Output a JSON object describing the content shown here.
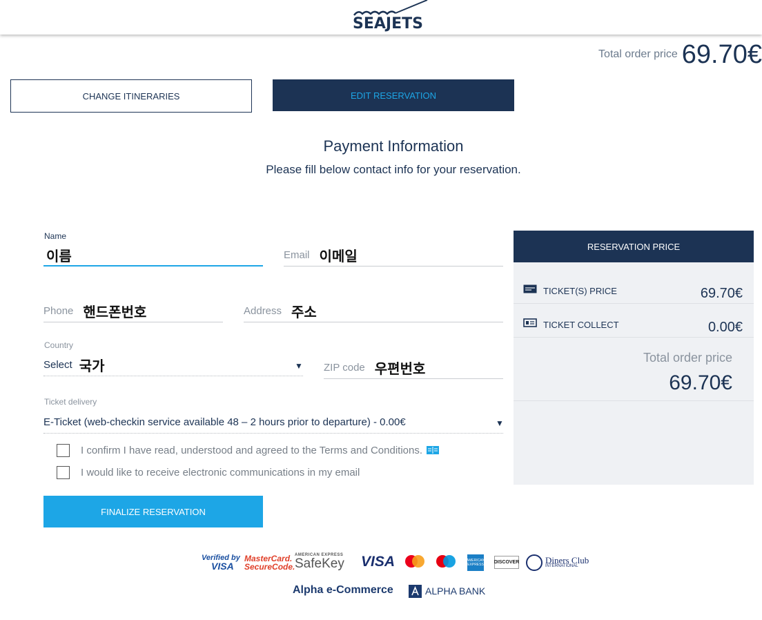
{
  "header": {
    "logo_text": "SEAJETS",
    "total_label": "Total order price",
    "total_value": "69.70€"
  },
  "actions": {
    "change_itineraries": "CHANGE ITINERARIES",
    "edit_reservation": "EDIT RESERVATION",
    "finalize": "FINALIZE RESERVATION"
  },
  "heading": {
    "title": "Payment Information",
    "subtitle": "Please fill below contact info for your reservation."
  },
  "form": {
    "name_label": "Name",
    "name_value": "이름",
    "email_placeholder": "Email",
    "email_value": "이메일",
    "phone_placeholder": "Phone",
    "phone_value": "핸드폰번호",
    "address_placeholder": "Address",
    "address_value": "주소",
    "country_label": "Country",
    "country_select": "Select",
    "country_value": "국가",
    "zip_placeholder": "ZIP code",
    "zip_value": "우편번호",
    "ticket_delivery_label": "Ticket delivery",
    "ticket_delivery_value": "E-Ticket (web-checkin service available 48 – 2 hours prior to departure) - 0.00€",
    "terms_text": "I confirm I have read, understood and agreed to the Terms and Conditions.",
    "newsletter_text": "I would like to receive electronic communications in my email"
  },
  "reservation_price": {
    "header": "RESERVATION PRICE",
    "rows": [
      {
        "label": "TICKET(S) PRICE",
        "amount": "69.70€",
        "icon": "ticket-icon"
      },
      {
        "label": "TICKET COLLECT",
        "amount": "0.00€",
        "icon": "id-card-icon"
      }
    ],
    "total_label": "Total order price",
    "total_value": "69.70€"
  },
  "payment_logos": {
    "verified_by": "Verified by",
    "verified_visa": "VISA",
    "mastercard": "MasterCard.",
    "securecode": "SecureCode.",
    "amex_small": "AMERICAN EXPRESS",
    "safekey": "SafeKey",
    "visa": "VISA",
    "amex_box": "AMERICAN EXPRESS",
    "discover": "DISCOVER",
    "diners": "Diners Club",
    "diners_sub": "INTERNATIONAL",
    "alpha_ecommerce": "Alpha e-Commerce",
    "alpha_bank": "ALPHA BANK"
  },
  "colors": {
    "navy": "#1c3354",
    "accent_blue": "#1da6e6",
    "panel_bg": "#eff1f4"
  }
}
